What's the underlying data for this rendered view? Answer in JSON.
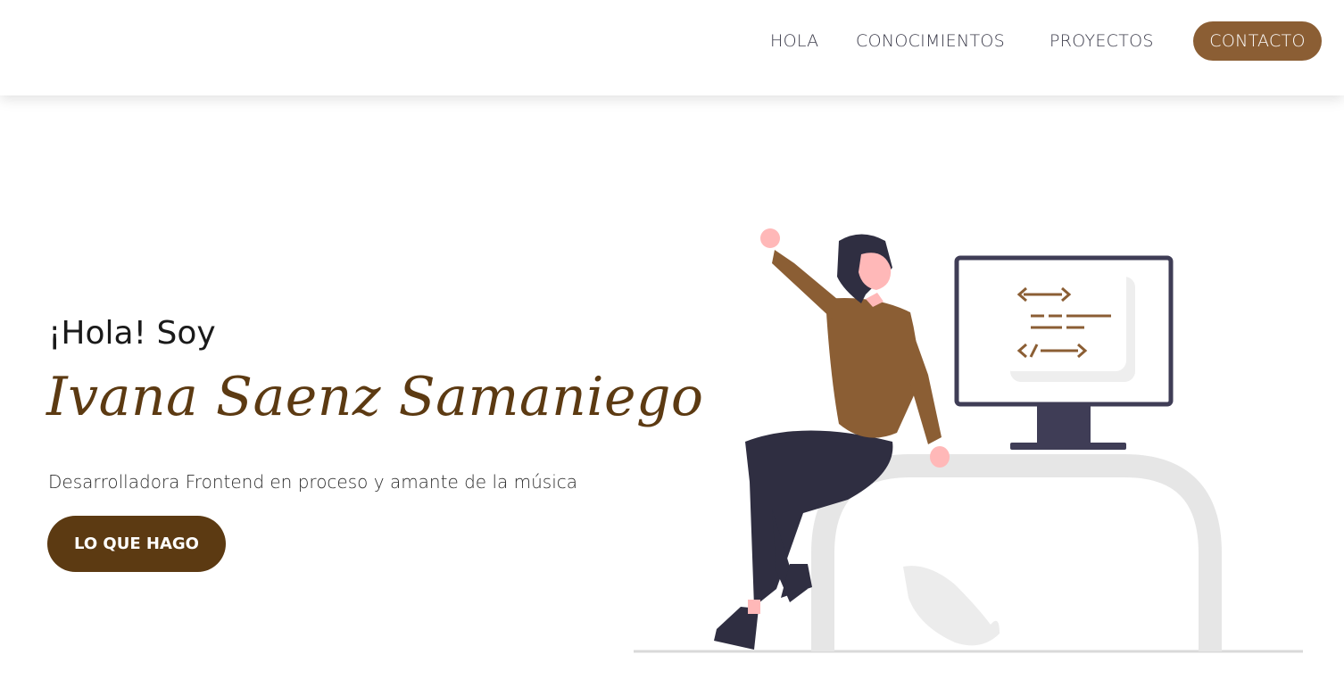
{
  "nav": {
    "links": [
      "HOLA",
      "CONOCIMIENTOS",
      "PROYECTOS"
    ],
    "cta": "CONTACTO"
  },
  "hero": {
    "greeting": "¡Hola! Soy",
    "name": "Ivana Saenz Samaniego",
    "subtitle": "Desarrolladora Frontend en proceso y amante de la música",
    "button": "LO QUE HAGO"
  },
  "illustration": {
    "monitor_code_lines": [
      "<—>",
      "— — —",
      "</—>"
    ]
  },
  "colors": {
    "accent": "#8b5e34",
    "dark_brown": "#5c3a12",
    "monitor": "#3f3d56",
    "pants": "#2f2e41",
    "skin": "#ffb8b8"
  }
}
